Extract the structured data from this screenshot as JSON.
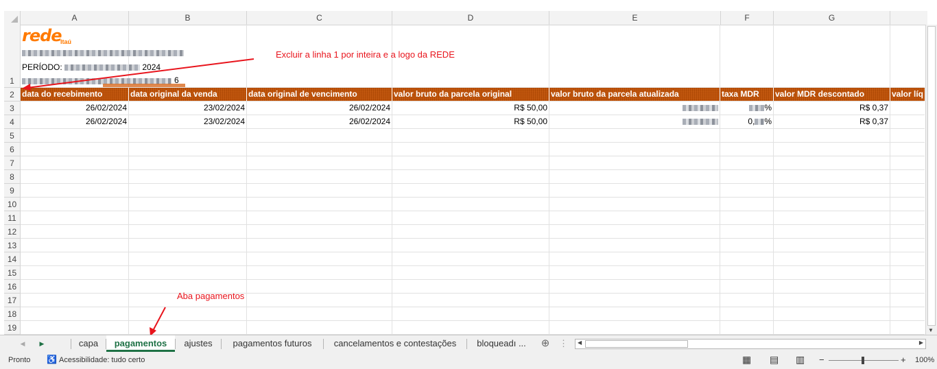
{
  "columns": [
    "A",
    "B",
    "C",
    "D",
    "E",
    "F",
    "G"
  ],
  "rows": [
    "1",
    "2",
    "3",
    "4",
    "5",
    "6",
    "7",
    "8",
    "9",
    "10",
    "11",
    "12",
    "13",
    "14",
    "15",
    "16",
    "17",
    "18",
    "19"
  ],
  "logo": {
    "main": "rede",
    "sub": "Itaú"
  },
  "periodo_label": "PERÍODO:",
  "periodo_partial": "2024",
  "row1_trailing": "6",
  "headers": [
    "data do recebimento",
    "data original da venda",
    "data original de vencimento",
    "valor bruto da parcela original",
    "valor bruto da parcela atualizada",
    "taxa MDR",
    "valor MDR descontado",
    "valor líq"
  ],
  "data_rows": [
    {
      "a": "26/02/2024",
      "b": "23/02/2024",
      "c": "26/02/2024",
      "d": "R$ 50,00",
      "f": "%",
      "g": "R$ 0,37"
    },
    {
      "a": "26/02/2024",
      "b": "23/02/2024",
      "c": "26/02/2024",
      "d": "R$ 50,00",
      "f": "0,",
      "f2": "%",
      "g": "R$ 0,37"
    }
  ],
  "annotations": {
    "top": "Excluir a linha 1 por inteira e a logo da REDE",
    "bottom": "Aba pagamentos"
  },
  "tabs": [
    "capa",
    "pagamentos",
    "ajustes",
    "pagamentos futuros",
    "cancelamentos e contestações",
    "bloqueadı ..."
  ],
  "active_tab": "pagamentos",
  "status": {
    "mode": "Pronto",
    "accessibility": "Acessibilidade: tudo certo",
    "zoom": "100%"
  },
  "colors": {
    "header_fill": "#c55a11",
    "active_tab": "#1e7145",
    "annotation": "#e8141c",
    "logo": "#ff7a00"
  }
}
